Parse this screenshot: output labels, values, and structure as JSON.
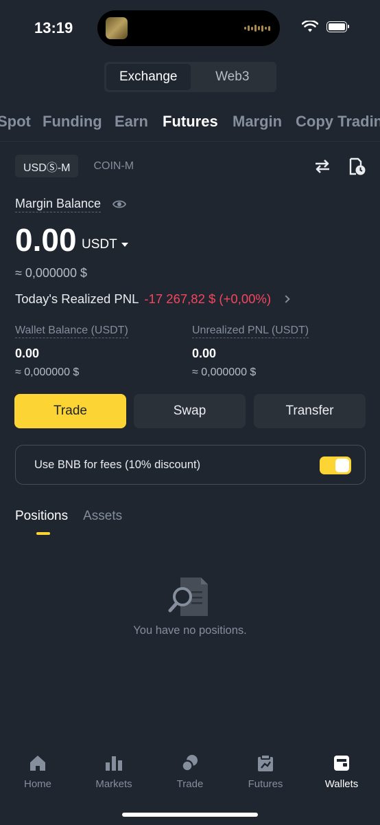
{
  "status_bar": {
    "time": "13:19"
  },
  "segment": {
    "items": [
      {
        "label": "Exchange"
      },
      {
        "label": "Web3"
      }
    ]
  },
  "top_tabs": [
    {
      "label": "Spot"
    },
    {
      "label": "Funding"
    },
    {
      "label": "Earn"
    },
    {
      "label": "Futures"
    },
    {
      "label": "Margin"
    },
    {
      "label": "Copy Trading"
    }
  ],
  "sub_tabs": [
    {
      "label": "USDⓈ-M"
    },
    {
      "label": "COIN-M"
    }
  ],
  "balance": {
    "label": "Margin Balance",
    "value": "0.00",
    "unit": "USDT",
    "approx": "≈ 0,000000 $",
    "pnl_label": "Today's Realized PNL",
    "pnl_value": "-17 267,82 $ (+0,00%)"
  },
  "columns": [
    {
      "label": "Wallet Balance (USDT)",
      "value": "0.00",
      "approx": "≈ 0,000000 $"
    },
    {
      "label": "Unrealized PNL (USDT)",
      "value": "0.00",
      "approx": "≈ 0,000000 $"
    }
  ],
  "actions": {
    "trade": "Trade",
    "swap": "Swap",
    "transfer": "Transfer"
  },
  "bnb": {
    "label": "Use BNB for fees (10% discount)",
    "enabled": true
  },
  "positions_tabs": [
    {
      "label": "Positions"
    },
    {
      "label": "Assets"
    }
  ],
  "empty": {
    "text": "You have no positions."
  },
  "bottom_nav": [
    {
      "label": "Home"
    },
    {
      "label": "Markets"
    },
    {
      "label": "Trade"
    },
    {
      "label": "Futures"
    },
    {
      "label": "Wallets"
    }
  ],
  "colors": {
    "background": "#1f2630",
    "accent": "#fcd535",
    "negative": "#f6465d",
    "muted": "#848e9c"
  }
}
